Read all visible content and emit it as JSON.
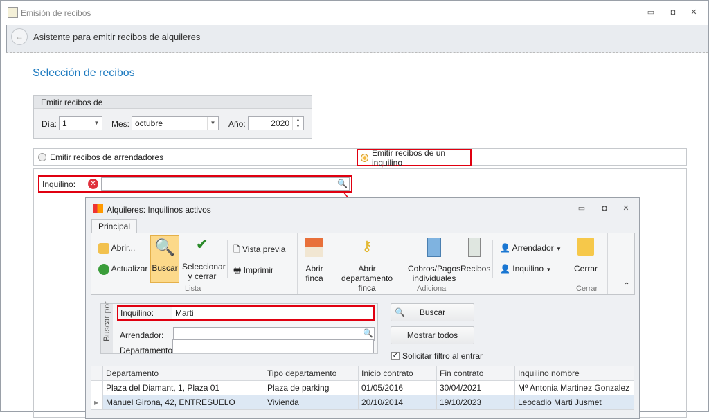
{
  "window": {
    "title": "Emisión de recibos",
    "header": "Asistente para emitir recibos de alquileres"
  },
  "section_title": "Selección de recibos",
  "group": {
    "title": "Emitir recibos de",
    "dia_label": "Día:",
    "dia": "1",
    "mes_label": "Mes:",
    "mes": "octubre",
    "anio_label": "Año:",
    "anio": "2020"
  },
  "radios": {
    "arrendadores": "Emitir recibos de arrendadores",
    "inquilino": "Emitir recibos de un inquilino",
    "selected": "inquilino"
  },
  "inquilino_label": "Inquilino:",
  "inner": {
    "title": "Alquileres: Inquilinos activos",
    "tab": "Principal",
    "ribbon": {
      "abrir": "Abrir...",
      "actualizar": "Actualizar",
      "buscar": "Buscar",
      "seleccionar": "Seleccionar",
      "y_cerrar": "y cerrar",
      "vista_previa": "Vista previa",
      "imprimir": "Imprimir",
      "lista": "Lista",
      "abrir_finca1": "Abrir",
      "abrir_finca2": "finca",
      "abrir_dep1": "Abrir departamento",
      "abrir_dep2": "finca",
      "cobros1": "Cobros/Pagos",
      "cobros2": "individuales",
      "recibos": "Recibos",
      "arrendador": "Arrendador",
      "inquilino": "Inquilino",
      "adicional": "Adicional",
      "cerrar": "Cerrar",
      "cerrar_group": "Cerrar"
    },
    "filter": {
      "group": "Buscar por",
      "inquilino_label": "Inquilino:",
      "inquilino": "Marti",
      "arrendador_label": "Arrendador:",
      "arrendador": "",
      "departamento_label": "Departamento:",
      "departamento": "",
      "buscar": "Buscar",
      "mostrar": "Mostrar todos",
      "solicitar": "Solicitar filtro al entrar",
      "solicitar_checked": true
    },
    "grid": {
      "columns": [
        "Departamento",
        "Tipo departamento",
        "Inicio contrato",
        "Fin contrato",
        "Inquilino nombre"
      ],
      "rows": [
        [
          "Plaza del Diamant, 1, Plaza 01",
          "Plaza de parking",
          "01/05/2016",
          "30/04/2021",
          "Mº Antonia Martinez Gonzalez"
        ],
        [
          "Manuel Girona, 42, ENTRESUELO",
          "Vivienda",
          "20/10/2014",
          "19/10/2023",
          "Leocadio Marti Jusmet"
        ]
      ],
      "selected_row": 1
    }
  },
  "colors": {
    "accent": "#1e7bc0",
    "highlight": "#e00010",
    "ribbon_active": "#fcd98a"
  }
}
